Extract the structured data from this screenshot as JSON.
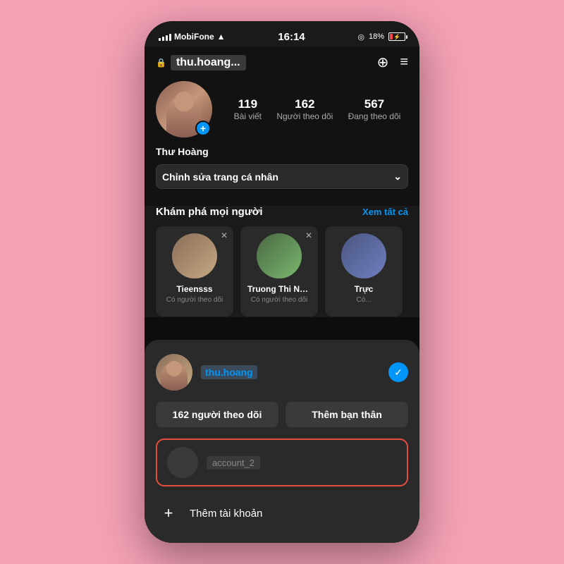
{
  "statusBar": {
    "carrier": "MobiFone",
    "time": "16:14",
    "battery": "18%"
  },
  "header": {
    "lock_icon": "🔒",
    "username": "thu.hoang...",
    "add_icon": "+",
    "menu_icon": "☰"
  },
  "profile": {
    "display_name": "Thư Hoàng",
    "stats": {
      "posts_count": "119",
      "posts_label": "Bài viết",
      "followers_count": "162",
      "followers_label": "Người theo dõi",
      "following_count": "567",
      "following_label": "Đang theo dõi"
    },
    "edit_button": "Chỉnh sửa trang cá nhân"
  },
  "discover": {
    "title": "Khám phá mọi người",
    "see_all": "Xem tất cả",
    "cards": [
      {
        "name": "Tieensss",
        "sub": "Có người theo dõi"
      },
      {
        "name": "Truong Thi Ngoc A...",
        "sub": "Có người theo dõi"
      },
      {
        "name": "Trực",
        "sub": "Có..."
      }
    ]
  },
  "bottomSheet": {
    "account_username": "thu.hoang",
    "followers_button": "162 người theo dõi",
    "add_friend_button": "Thêm bạn thân",
    "secondary_username": "account_2",
    "add_account_text": "Thêm tài khoản"
  }
}
